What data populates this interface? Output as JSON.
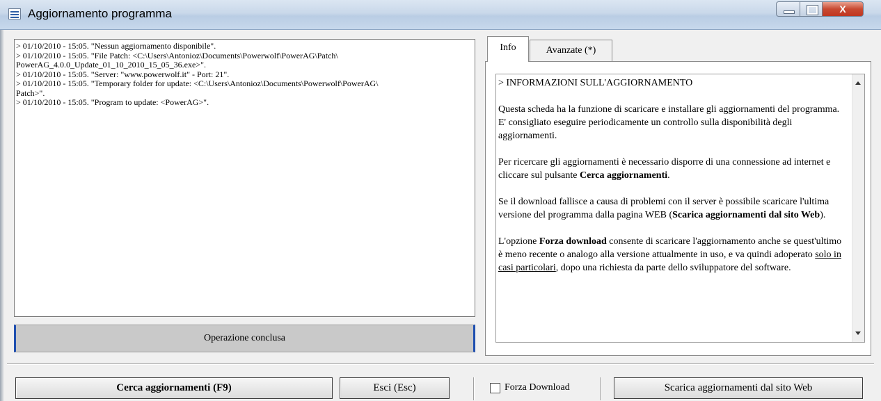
{
  "window": {
    "title": "Aggiornamento programma"
  },
  "log": {
    "lines": [
      "> 01/10/2010 - 15:05. \"Nessun aggiornamento disponibile\".",
      "> 01/10/2010 - 15:05. \"File Patch: <C:\\Users\\Antonioz\\Documents\\Powerwolf\\PowerAG\\Patch\\\nPowerAG_4.0.0_Update_01_10_2010_15_05_36.exe>\".",
      "> 01/10/2010 - 15:05. \"Server: \"www.powerwolf.it\" - Port: 21\".",
      "> 01/10/2010 - 15:05. \"Temporary folder for update: <C:\\Users\\Antonioz\\Documents\\Powerwolf\\PowerAG\\\nPatch>\".",
      "> 01/10/2010 - 15:05. \"Program to update: <PowerAG>\"."
    ]
  },
  "status": {
    "text": "Operazione conclusa"
  },
  "tabs": [
    {
      "label": "Info",
      "active": true
    },
    {
      "label": "Avanzate (*)",
      "active": false
    }
  ],
  "info": {
    "heading": "> INFORMAZIONI SULL'AGGIORNAMENTO",
    "p1": "Questa scheda ha la funzione di scaricare e installare gli aggiornamenti del programma. E' consigliato eseguire periodicamente un controllo sulla disponibilità degli aggiornamenti.",
    "p2_pre": "Per ricercare gli aggiornamenti è necessario disporre di una connessione ad internet e cliccare sul pulsante ",
    "p2_bold": "Cerca aggiornamenti",
    "p2_post": ".",
    "p3_pre": "Se il download fallisce a causa di problemi con il server è possibile scaricare l'ultima versione del programma dalla pagina WEB (",
    "p3_bold": "Scarica aggiornamenti dal sito Web",
    "p3_post": ").",
    "p4_pre": "L'opzione ",
    "p4_bold": "Forza download",
    "p4_mid": " consente di scaricare l'aggiornamento anche se quest'ultimo è meno recente o analogo alla versione attualmente in uso, e va quindi adoperato ",
    "p4_underline": "solo in casi particolari",
    "p4_post": ", dopo una richiesta da parte dello sviluppatore del software."
  },
  "buttons": {
    "cerca": "Cerca aggiornamenti  (F9)",
    "esci": "Esci  (Esc)",
    "scarica": "Scarica aggiornamenti dal sito Web"
  },
  "checkbox": {
    "label": "Forza Download",
    "checked": false
  },
  "icons": {
    "app": "app-window-icon",
    "minimize": "minimize-icon",
    "maximize": "maximize-icon",
    "close": "close-icon",
    "scroll_up": "scroll-up-arrow-icon",
    "scroll_down": "scroll-down-arrow-icon"
  }
}
